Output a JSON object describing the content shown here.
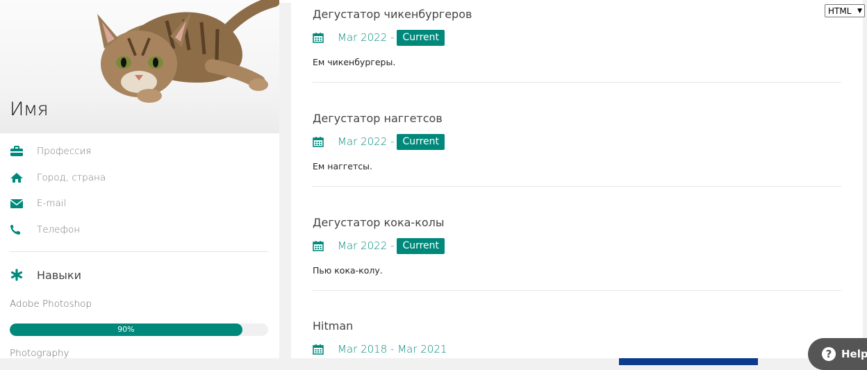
{
  "profile": {
    "name": "Имя",
    "info": [
      {
        "label": "Профессия",
        "icon": "briefcase-icon"
      },
      {
        "label": "Город, страна",
        "icon": "home-icon"
      },
      {
        "label": "E-mail",
        "icon": "envelope-icon"
      },
      {
        "label": "Телефон",
        "icon": "phone-icon"
      }
    ],
    "skills_title": "Навыки",
    "skills": [
      {
        "name": "Adobe Photoshop",
        "percent": 90,
        "percent_label": "90%"
      },
      {
        "name": "Photography"
      }
    ]
  },
  "experience": [
    {
      "title": "Дегустатор чикенбургеров",
      "dates": "Mar 2022 -",
      "current": "Current",
      "description": "Ем чикенбургеры."
    },
    {
      "title": "Дегустатор наггетсов",
      "dates": "Mar 2022 -",
      "current": "Current",
      "description": "Ем наггетсы."
    },
    {
      "title": "Дегустатор кока-колы",
      "dates": "Mar 2022 -",
      "current": "Current",
      "description": "Пью кока-колу."
    },
    {
      "title": "Hitman",
      "dates": "Mar 2018 - Mar 2021"
    }
  ],
  "format_select": {
    "value": "HTML"
  },
  "help_widget": {
    "label": "Help"
  },
  "colors": {
    "accent": "#00897b",
    "background": "#f1f1f1",
    "card": "#ffffff"
  }
}
